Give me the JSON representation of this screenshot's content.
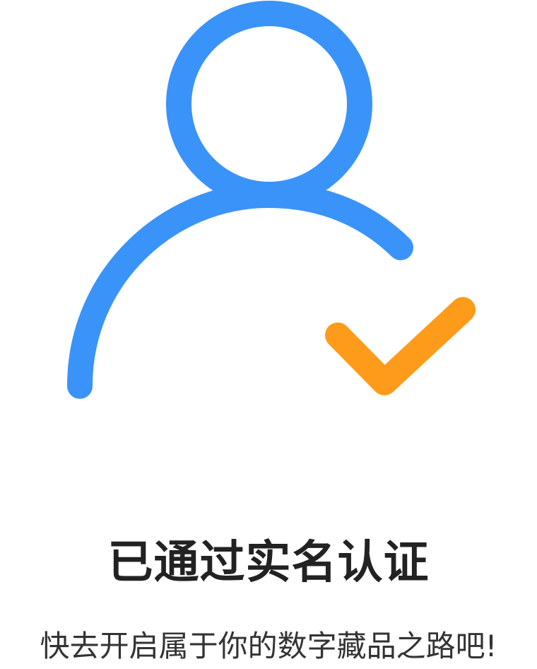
{
  "icons": {
    "main": "verified-user-icon",
    "check": "checkmark-icon"
  },
  "colors": {
    "user_blue": "#3A93F8",
    "check_orange": "#FF9B1A",
    "title_text": "#222222",
    "subtitle_text": "#333333",
    "background": "#FFFFFF"
  },
  "status": {
    "title": "已通过实名认证",
    "subtitle": "快去开启属于你的数字藏品之路吧!"
  }
}
